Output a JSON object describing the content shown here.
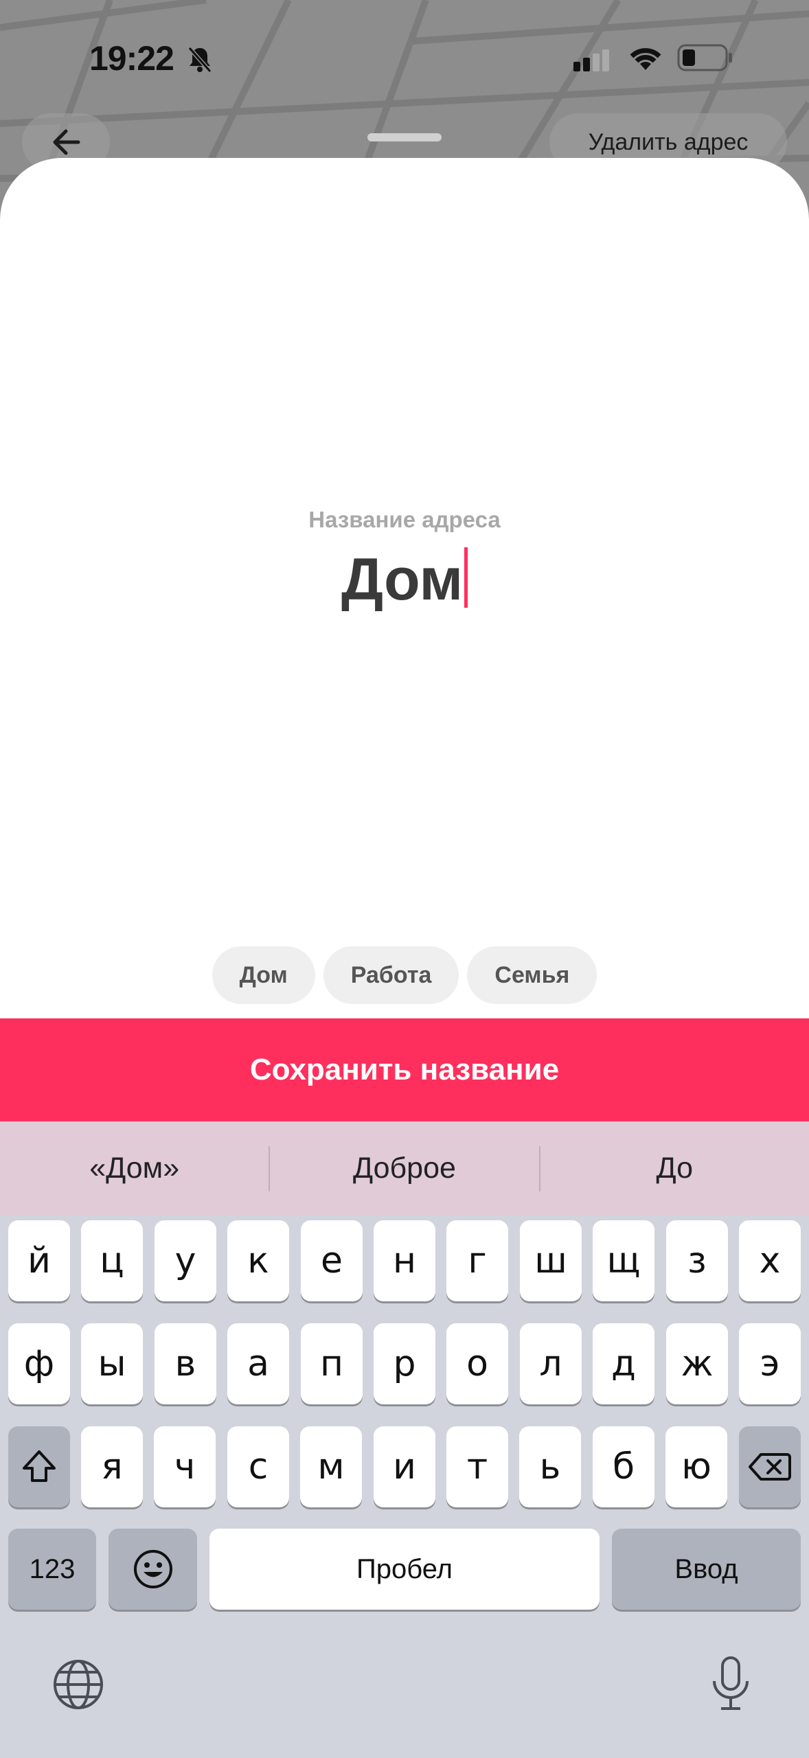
{
  "status_bar": {
    "time": "19:22"
  },
  "nav": {
    "delete_label": "Удалить адрес",
    "back_icon": "arrow-left-icon"
  },
  "form": {
    "label": "Название адреса",
    "value": "Дом"
  },
  "chips": [
    "Дом",
    "Работа",
    "Семья"
  ],
  "save_button": "Сохранить название",
  "keyboard": {
    "suggestions": [
      "«Дом»",
      "Доброе",
      "До"
    ],
    "row1": [
      "й",
      "ц",
      "у",
      "к",
      "е",
      "н",
      "г",
      "ш",
      "щ",
      "з",
      "х"
    ],
    "row2": [
      "ф",
      "ы",
      "в",
      "а",
      "п",
      "р",
      "о",
      "л",
      "д",
      "ж",
      "э"
    ],
    "row3": [
      "я",
      "ч",
      "с",
      "м",
      "и",
      "т",
      "ь",
      "б",
      "ю"
    ],
    "numbers_key": "123",
    "space_key": "Пробел",
    "return_key": "Ввод"
  },
  "colors": {
    "accent": "#ff2f5d",
    "caret": "#ff2f5e",
    "suggestion_bar": "#e0cbd6"
  }
}
